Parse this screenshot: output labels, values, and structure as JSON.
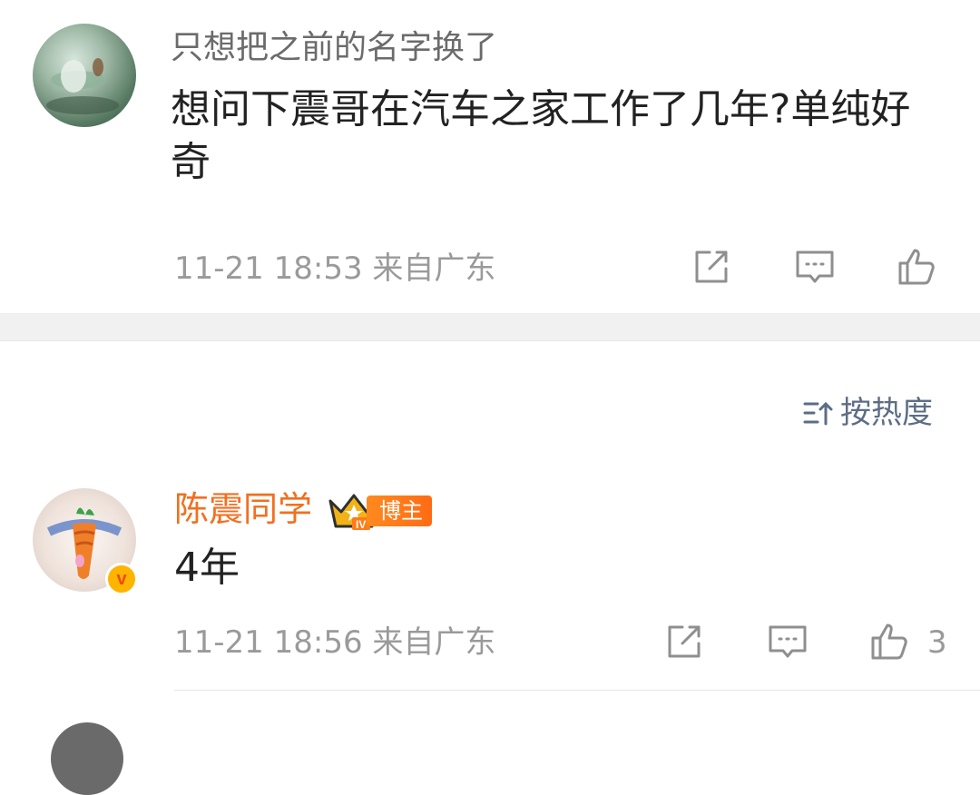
{
  "comment1": {
    "username": "只想把之前的名字换了",
    "text": "想问下震哥在汽车之家工作了几年?单纯好奇",
    "meta": "11-21 18:53 来自广东",
    "icons": [
      "share-icon",
      "comment-icon",
      "like-icon"
    ]
  },
  "sort": {
    "label": "按热度",
    "icon": "sort-icon"
  },
  "reply": {
    "username": "陈震同学",
    "badge": "博主",
    "text": "4年",
    "meta": "11-21 18:56 来自广东",
    "like_count": "3",
    "colors": {
      "username": "#f26f1f",
      "badge_bg": "#ff7a18",
      "verified": "#ffb400"
    }
  }
}
